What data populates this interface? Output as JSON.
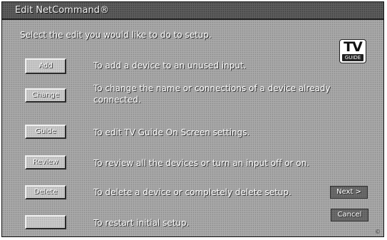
{
  "window": {
    "title": "Edit NetCommand®"
  },
  "instruction": "Select the edit you would like to do to setup.",
  "logo": {
    "line1": "TV",
    "line2": "GUIDE"
  },
  "options": [
    {
      "button": "Add",
      "description": "To add a device to an unused input."
    },
    {
      "button": "Change",
      "description": "To change the name or connections of a device already connected."
    },
    {
      "button": "Guide",
      "description": "To edit TV Guide On Screen settings."
    },
    {
      "button": "Review",
      "description": "To review all the devices or turn an input off or on."
    },
    {
      "button": "Delete",
      "description": "To delete a device or completely delete setup."
    },
    {
      "button": "",
      "description": "To restart initial setup."
    }
  ],
  "nav": {
    "next_label": "Next >",
    "cancel_label": "Cancel"
  },
  "corner_mark": "©"
}
